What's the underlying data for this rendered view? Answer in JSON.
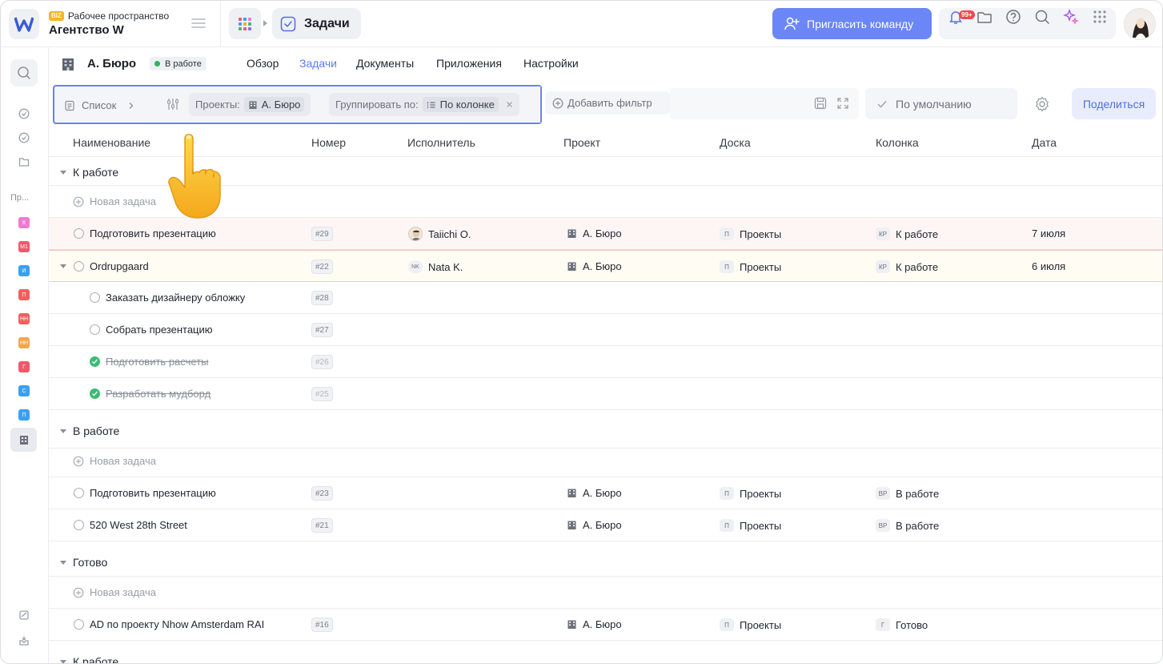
{
  "workspace": {
    "badge": "BIZ",
    "label": "Рабочее пространство",
    "name": "Агентство W"
  },
  "breadcrumb": {
    "current": "Задачи"
  },
  "header": {
    "invite_label": "Пригласить команду",
    "notifications_count": "99+"
  },
  "rail": {
    "section_label": "Пр...",
    "projects": [
      {
        "abbr": "К",
        "color": "#f07ad2"
      },
      {
        "abbr": "М1",
        "color": "#ef5a6a"
      },
      {
        "abbr": "И",
        "color": "#3aa0f0"
      },
      {
        "abbr": "П",
        "color": "#ef6060"
      },
      {
        "abbr": "НН",
        "color": "#ef6060"
      },
      {
        "abbr": "НН",
        "color": "#f3a64a"
      },
      {
        "abbr": "Г",
        "color": "#ef5a6a"
      },
      {
        "abbr": "С",
        "color": "#3aa0f0"
      },
      {
        "abbr": "П",
        "color": "#3aa0f0"
      }
    ]
  },
  "project": {
    "title": "А. Бюро",
    "status": "В работе",
    "tabs": [
      "Обзор",
      "Задачи",
      "Документы",
      "Приложения",
      "Настройки"
    ],
    "active_tab": "Задачи"
  },
  "filters": {
    "view": "Список",
    "projects_label": "Проекты:",
    "projects_value": "А. Бюро",
    "group_label": "Группировать по:",
    "group_value": "По колонке",
    "add_filter": "Добавить фильтр",
    "sort": "По умолчанию",
    "share": "Поделиться"
  },
  "table": {
    "columns": [
      "Наименование",
      "Номер",
      "Исполнитель",
      "Проект",
      "Доска",
      "Колонка",
      "Дата"
    ],
    "new_task_label": "Новая задача",
    "groups": [
      {
        "title": "К работе"
      },
      {
        "title": "В работе"
      },
      {
        "title": "Готово"
      },
      {
        "title": "К работе"
      }
    ],
    "rows": [
      {
        "name": "Подготовить презентацию",
        "number": "#29",
        "assignee": "Taiichi O.",
        "project": "А. Бюро",
        "board_tag": "П",
        "board": "Проекты",
        "column_tag": "КР",
        "column": "К работе",
        "date": "7 июля"
      },
      {
        "name": "Ordrupgaard",
        "number": "#22",
        "assignee_tag": "NK",
        "assignee": "Nata K.",
        "project": "А. Бюро",
        "board_tag": "П",
        "board": "Проекты",
        "column_tag": "КР",
        "column": "К работе",
        "date": "6 июля"
      },
      {
        "name": "Заказать дизайнеру обложку",
        "number": "#28"
      },
      {
        "name": "Собрать презентацию",
        "number": "#27"
      },
      {
        "name": "Подготовить расчеты",
        "number": "#26"
      },
      {
        "name": "Разработать мудборд",
        "number": "#25"
      },
      {
        "name": "Подготовить презентацию",
        "number": "#23",
        "project": "А. Бюро",
        "board_tag": "П",
        "board": "Проекты",
        "column_tag": "ВР",
        "column": "В работе"
      },
      {
        "name": "520 West 28th Street",
        "number": "#21",
        "project": "А. Бюро",
        "board_tag": "П",
        "board": "Проекты",
        "column_tag": "ВР",
        "column": "В работе"
      },
      {
        "name": "AD по проекту Nhow Amsterdam RAI",
        "number": "#16",
        "project": "А. Бюро",
        "board_tag": "П",
        "board": "Проекты",
        "column_tag": "Г",
        "column": "Готово"
      }
    ]
  },
  "colors": {
    "accent": "#6b86f6",
    "done": "#3bbb73",
    "status_green": "#2db35b",
    "highlight_border": "#6d82e8"
  }
}
